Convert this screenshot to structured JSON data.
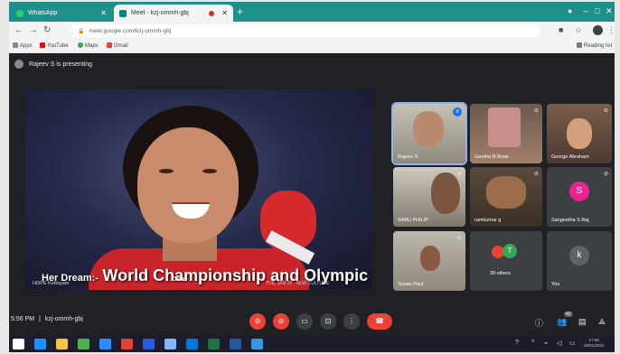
{
  "browser": {
    "tabs": [
      {
        "label": "WhatsApp",
        "active": false
      },
      {
        "label": "Meet - kzj-ommh-gbj",
        "active": true
      }
    ],
    "url": "meet.google.com/kzj-ommh-gbj",
    "bookmarks": [
      "Apps",
      "YouTube",
      "Maps",
      "Gmail"
    ],
    "reading_list": "Reading list"
  },
  "meet": {
    "presenting_text": "Rajeev S is presenting",
    "slide": {
      "caption_prefix": "Her Dream:-",
      "caption_main": "World Championship and Olympic medal",
      "credit_left": "HOPE Kottayam",
      "credit_right": "TUE, JAN 26 · NEW CULTURE",
      "brand": "Dida"
    },
    "participants": [
      {
        "name": "Rajeev S",
        "speaking": true
      },
      {
        "name": "Geetha R Bose"
      },
      {
        "name": "George Abraham"
      },
      {
        "name": "SABU PHILIP"
      },
      {
        "name": "ramkumar g"
      },
      {
        "name": "Sangeetha S Raj",
        "initial": "S",
        "color": "#e52592"
      },
      {
        "name": "Susan Paul"
      },
      {
        "name": "39 others",
        "initial": "T",
        "color": "#34a853"
      },
      {
        "name": "You",
        "initial": "k",
        "color": "#5f6368"
      }
    ],
    "meeting_time": "5:56 PM",
    "meeting_code": "kzj-ommh-gbj",
    "people_count": "42"
  },
  "colors": {
    "accent": "#1a73e8",
    "danger": "#ea4335",
    "meet_bg": "#202124"
  },
  "taskbar": {
    "time": "17:56",
    "date": "26/01/2021"
  }
}
